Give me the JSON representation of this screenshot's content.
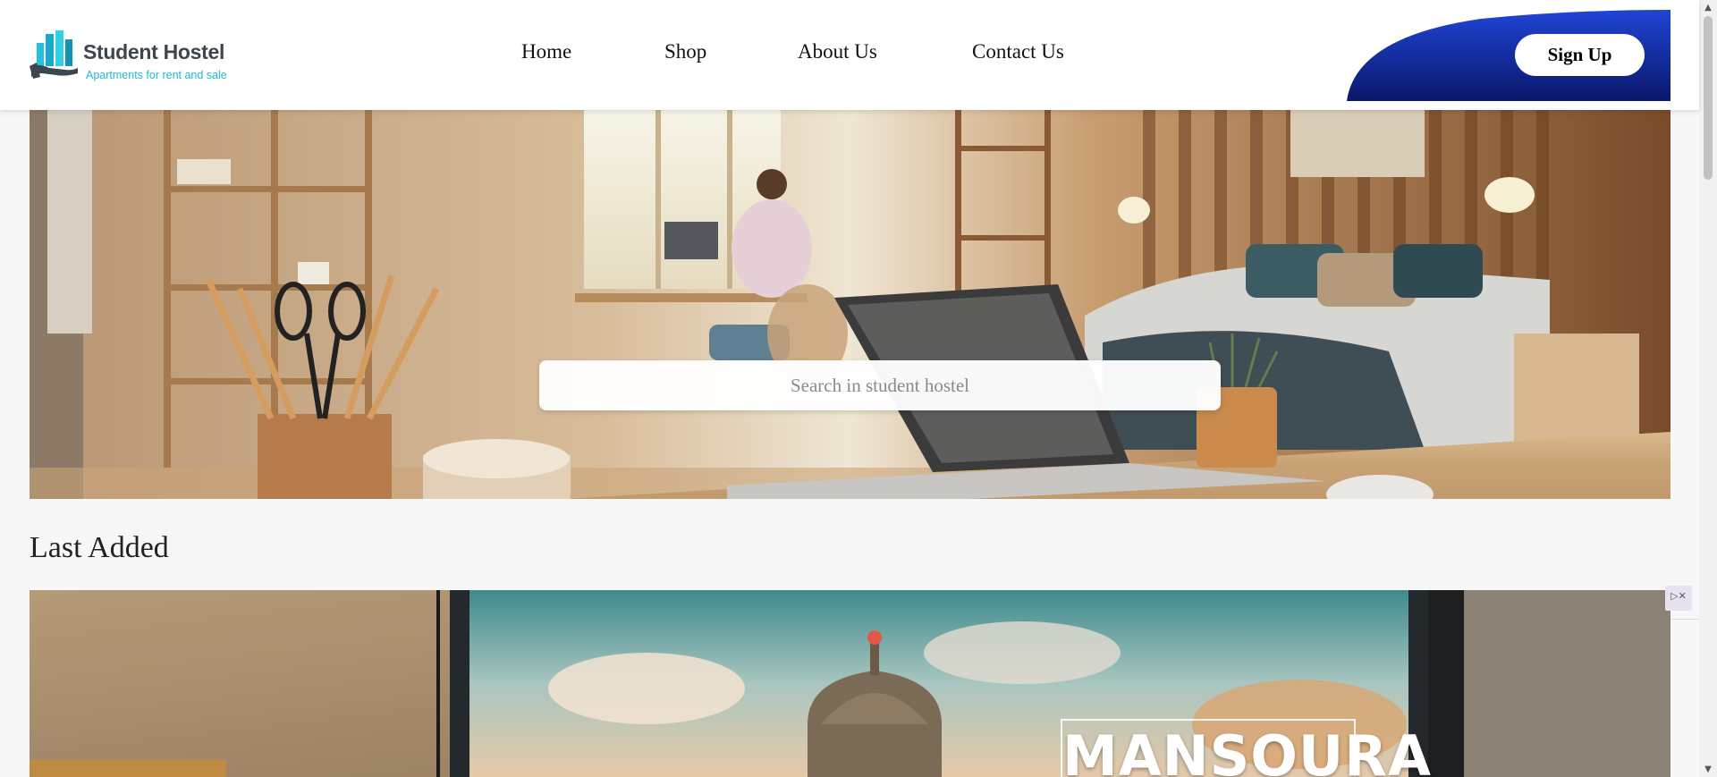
{
  "brand": {
    "name": "Student Hostel",
    "tagline": "Apartments for rent and sale"
  },
  "nav": {
    "items": [
      {
        "label": "Home"
      },
      {
        "label": "Shop"
      },
      {
        "label": "About Us"
      },
      {
        "label": "Contact Us"
      }
    ],
    "signup_label": "Sign Up"
  },
  "hero": {
    "search_placeholder": "Search in student hostel"
  },
  "sections": {
    "last_added_title": "Last Added"
  },
  "listing": {
    "sign_text": "MANSOURA"
  },
  "ad": {
    "close_glyph": "▷✕"
  },
  "colors": {
    "signup_gradient_top": "#1e3fd0",
    "signup_gradient_bottom": "#0a1a6e",
    "logo_accent": "#1fb8d8",
    "logo_text": "#3c4650"
  },
  "icons": {
    "scroll_up": "▲",
    "scroll_down": "▼"
  }
}
